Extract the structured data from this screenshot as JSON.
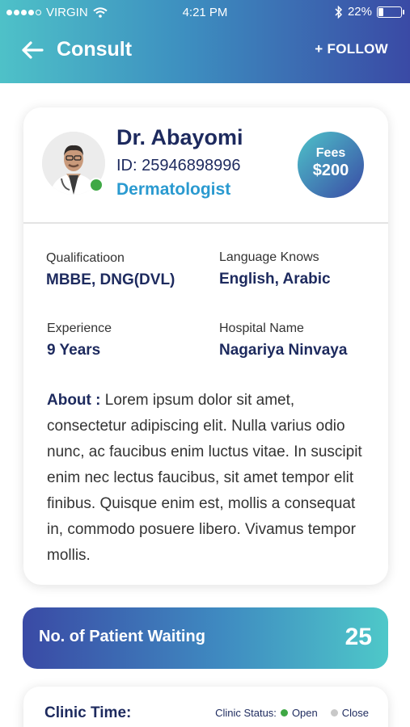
{
  "status_bar": {
    "carrier": "VIRGIN",
    "time": "4:21 PM",
    "battery": "22%",
    "battery_level": 0.22
  },
  "header": {
    "title": "Consult",
    "follow_label": "+ FOLLOW",
    "back_icon": "arrow-left-icon"
  },
  "doctor": {
    "name": "Dr. Abayomi",
    "id_text": "ID: 25946898996",
    "specialty": "Dermatologist",
    "fees_label": "Fees",
    "fees_amount": "$200",
    "online": true
  },
  "info": {
    "qualification_label": "Qualificatioon",
    "qualification_value": "MBBE, DNG(DVL)",
    "language_label": "Language Knows",
    "language_value": "English, Arabic",
    "experience_label": "Experience",
    "experience_value": "9 Years",
    "hospital_label": "Hospital Name",
    "hospital_value": "Nagariya Ninvaya"
  },
  "about": {
    "label": "About :",
    "text": " Lorem ipsum dolor sit amet, consectetur adipiscing elit. Nulla varius odio nunc, ac faucibus enim luctus vitae. In suscipit enim nec lectus faucibus, sit amet tempor elit finibus. Quisque enim est, mollis a consequat in, commodo posuere libero. Vivamus tempor mollis."
  },
  "waiting": {
    "label": "No. of Patient Waiting",
    "count": "25"
  },
  "clinic": {
    "title": "Clinic Time:",
    "status_label": "Clinic Status:",
    "open_label": "Open",
    "close_label": "Close",
    "open_color": "#3fa845",
    "close_color": "#c8c8c8"
  },
  "colors": {
    "navy": "#1d2a5e",
    "accent_blue": "#2a9ad0",
    "gradient_teal": "#4ec1c8",
    "gradient_indigo": "#3a4aa5"
  }
}
